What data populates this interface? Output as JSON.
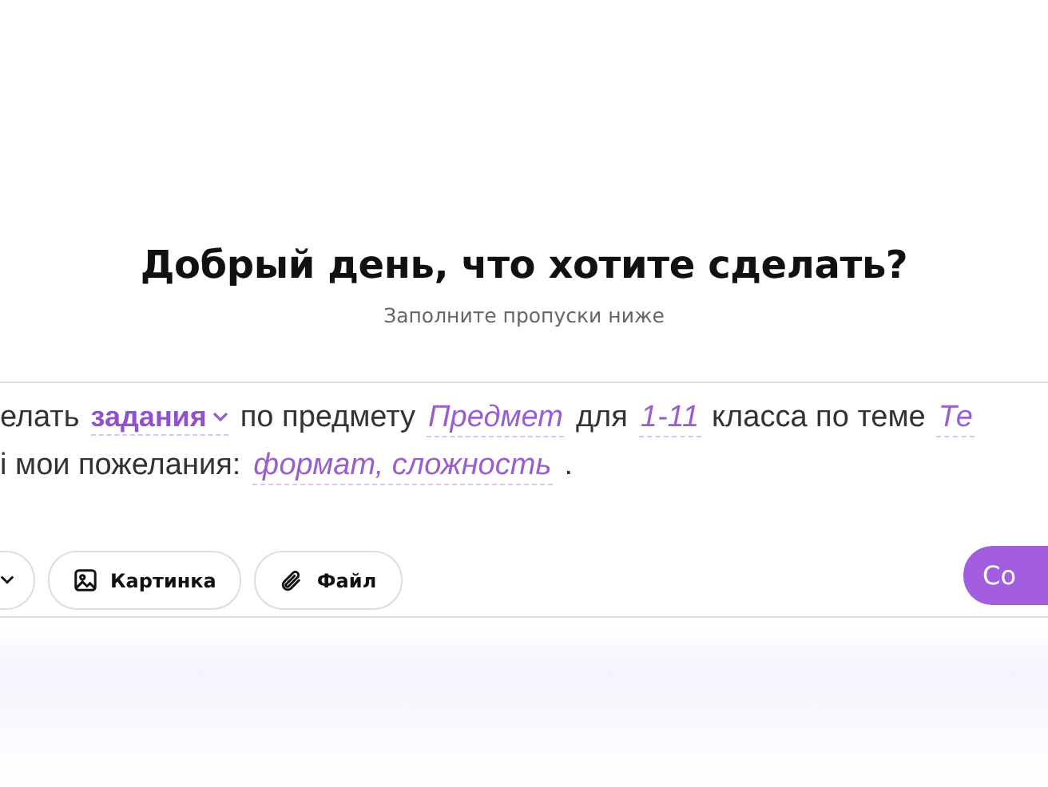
{
  "heading": "Добрый день, что хотите сделать?",
  "subtitle": "Заполните пропуски ниже",
  "prompt_lines": [
    [
      {
        "kind": "text",
        "text": "елать"
      },
      {
        "kind": "dropdown",
        "text": "задания"
      },
      {
        "kind": "text",
        "text": "по предмету"
      },
      {
        "kind": "field",
        "text": "Предмет"
      },
      {
        "kind": "text",
        "text": "для"
      },
      {
        "kind": "field",
        "text": "1-11"
      },
      {
        "kind": "text",
        "text": "класса по теме"
      },
      {
        "kind": "field",
        "text": "Те"
      }
    ],
    [
      {
        "kind": "text",
        "text": "і мои пожелания:"
      },
      {
        "kind": "field",
        "text": "формат, сложность"
      },
      {
        "kind": "text",
        "text": "."
      }
    ]
  ],
  "tools": [
    {
      "kind": "cut-dropdown"
    },
    {
      "kind": "image",
      "label": "Картинка"
    },
    {
      "kind": "file",
      "label": "Файл"
    }
  ],
  "submit": {
    "label": "Со"
  }
}
